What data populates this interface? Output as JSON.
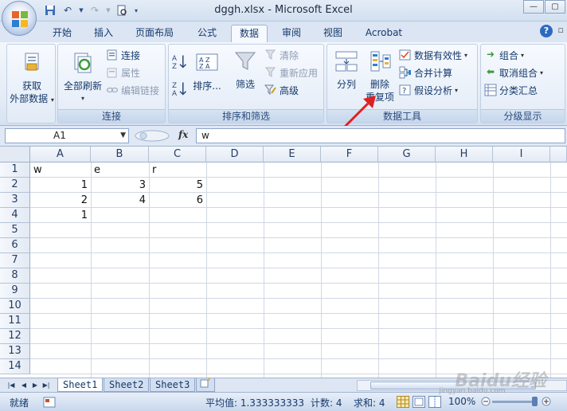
{
  "window": {
    "title": "dggh.xlsx - Microsoft Excel"
  },
  "tabs": [
    "开始",
    "插入",
    "页面布局",
    "公式",
    "数据",
    "审阅",
    "视图",
    "Acrobat"
  ],
  "active_tab": "数据",
  "ribbon": {
    "get_external": {
      "line1": "获取",
      "line2": "外部数据"
    },
    "connections": {
      "label": "连接",
      "refresh_all": "全部刷新",
      "connect": "连接",
      "properties": "属性",
      "edit_links": "编辑链接"
    },
    "sort_filter": {
      "label": "排序和筛选",
      "sort": "排序...",
      "filter": "筛选",
      "clear": "清除",
      "reapply": "重新应用",
      "advanced": "高级"
    },
    "data_tools": {
      "label": "数据工具",
      "split": "分列",
      "remove_dup_1": "删除",
      "remove_dup_2": "重复项",
      "validation": "数据有效性",
      "consolidate": "合并计算",
      "whatif": "假设分析"
    },
    "outline": {
      "label": "分级显示",
      "group": "组合",
      "ungroup": "取消组合",
      "subtotal": "分类汇总"
    }
  },
  "formula_bar": {
    "name_box": "A1",
    "fx": "fx",
    "content": "w"
  },
  "columns": [
    "A",
    "B",
    "C",
    "D",
    "E",
    "F",
    "G",
    "H",
    "I"
  ],
  "rows": [
    "1",
    "2",
    "3",
    "4",
    "5",
    "6",
    "7",
    "8",
    "9",
    "10",
    "11",
    "12",
    "13",
    "14"
  ],
  "cells": {
    "A1": "w",
    "B1": "e",
    "C1": "r",
    "A2": "1",
    "B2": "3",
    "C2": "5",
    "A3": "2",
    "B3": "4",
    "C3": "6",
    "A4": "1"
  },
  "sheets": [
    "Sheet1",
    "Sheet2",
    "Sheet3"
  ],
  "status": {
    "ready": "就绪",
    "average": "平均值: 1.333333333",
    "count": "计数: 4",
    "sum": "求和: 4",
    "zoom": "100%"
  },
  "watermark": {
    "main": "Baidu经验",
    "sub": "jingyan.baidu.com"
  }
}
